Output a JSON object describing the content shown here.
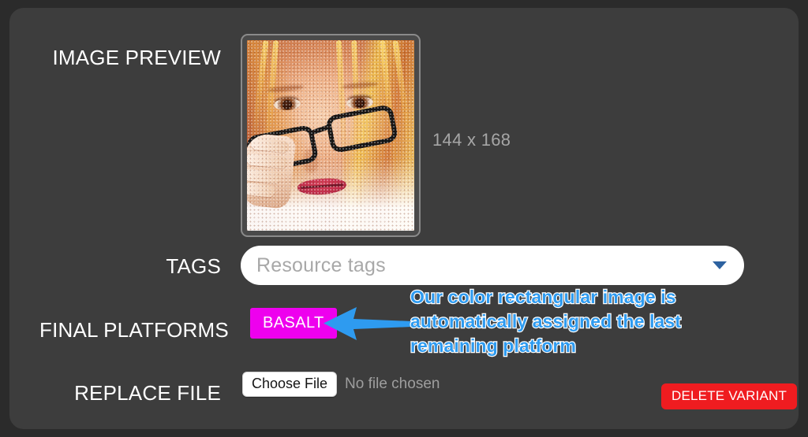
{
  "panel": {
    "background_color": "#3d3d3d",
    "page_background_color": "#2b2b2b"
  },
  "rows": {
    "image_preview": {
      "label": "IMAGE PREVIEW",
      "dimensions": "144 x 168",
      "image_description": "portrait photo of a blonde woman holding eyeglasses"
    },
    "tags": {
      "label": "TAGS",
      "placeholder": "Resource tags",
      "value": "",
      "caret_icon": "chevron-down-icon"
    },
    "final_platforms": {
      "label": "FINAL PLATFORMS",
      "platforms": [
        {
          "name": "BASALT",
          "color": "#ee00ee"
        }
      ]
    },
    "replace_file": {
      "label": "REPLACE FILE",
      "choose_file_label": "Choose File",
      "file_status": "No file chosen"
    }
  },
  "actions": {
    "delete_variant_label": "DELETE VARIANT",
    "delete_variant_color": "#ef1c20"
  },
  "annotation": {
    "text": "Our color rectangular image is automatically assigned the last remaining platform",
    "text_color": "#2e9bf0",
    "outline_color": "#ffffff",
    "arrow_icon": "left-arrow-icon",
    "arrow_color": "#2e9bf0"
  }
}
